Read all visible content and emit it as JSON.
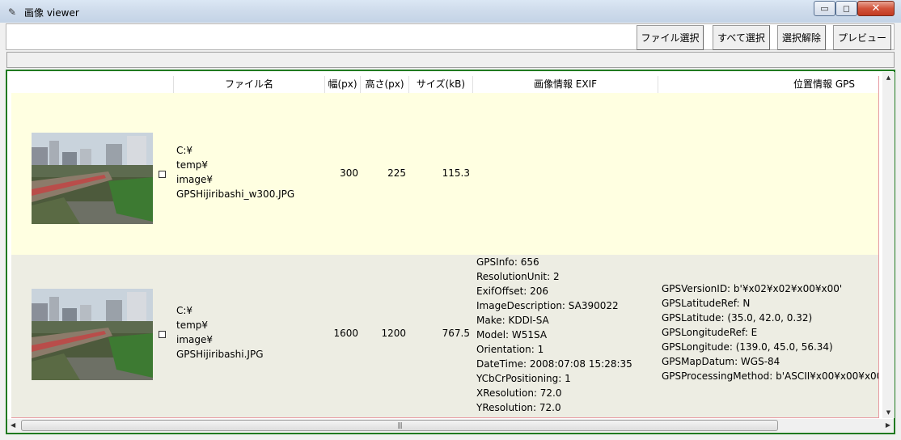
{
  "window": {
    "title": "画像 viewer",
    "minimize_glyph": "▭",
    "maximize_glyph": "◻",
    "close_glyph": "✕"
  },
  "toolbar": {
    "file_select": "ファイル選択",
    "select_all": "すべて選択",
    "deselect": "選択解除",
    "preview": "プレビュー"
  },
  "table": {
    "columns": [
      "",
      "ファイル名",
      "幅(px)",
      "高さ(px)",
      "サイズ(kB)",
      "画像情報 EXIF",
      "位置情報 GPS"
    ],
    "rows": [
      {
        "path_lines": [
          "C:¥",
          "temp¥",
          "image¥",
          "GPSHijiribashi_w300.JPG"
        ],
        "width": "300",
        "height": "225",
        "size": "115.3",
        "exif": [],
        "gps": []
      },
      {
        "path_lines": [
          "C:¥",
          "temp¥",
          "image¥",
          "GPSHijiribashi.JPG"
        ],
        "width": "1600",
        "height": "1200",
        "size": "767.5",
        "exif": [
          "GPSInfo: 656",
          "ResolutionUnit: 2",
          "ExifOffset: 206",
          "ImageDescription: SA390022",
          "Make: KDDI-SA",
          "Model: W51SA",
          "Orientation: 1",
          "DateTime: 2008:07:08 15:28:35",
          "YCbCrPositioning: 1",
          "XResolution: 72.0",
          "YResolution: 72.0"
        ],
        "gps": [
          "GPSVersionID: b'¥x02¥x02¥x00¥x00'",
          "GPSLatitudeRef: N",
          "GPSLatitude: (35.0, 42.0, 0.32)",
          "GPSLongitudeRef: E",
          "GPSLongitude: (139.0, 45.0, 56.34)",
          "GPSMapDatum: WGS-84",
          "GPSProcessingMethod: b'ASCII¥x00¥x00¥x00"
        ]
      }
    ]
  },
  "scroll": {
    "grip": "|||",
    "arrow_left": "◀",
    "arrow_right": "▶",
    "arrow_up": "▲",
    "arrow_down": "▼"
  },
  "colors": {
    "frame_border": "#207a20",
    "row1_bg": "#ffffe1",
    "row2_bg": "#ededE3"
  }
}
